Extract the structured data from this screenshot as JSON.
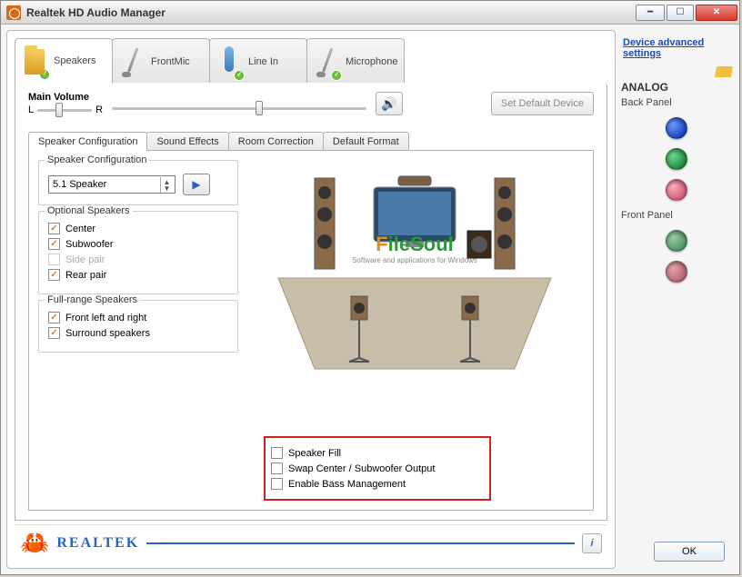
{
  "window": {
    "title": "Realtek HD Audio Manager"
  },
  "devtabs": {
    "speakers": "Speakers",
    "frontmic": "FrontMic",
    "linein": "Line In",
    "microphone": "Microphone"
  },
  "mainvol": {
    "label": "Main Volume",
    "L": "L",
    "R": "R",
    "setdef": "Set Default Device"
  },
  "innertabs": {
    "cfg": "Speaker Configuration",
    "fx": "Sound Effects",
    "room": "Room Correction",
    "fmt": "Default Format"
  },
  "config": {
    "legend": "Speaker Configuration",
    "value": "5.1 Speaker"
  },
  "optional": {
    "legend": "Optional Speakers",
    "center": "Center",
    "subwoofer": "Subwoofer",
    "sidepair": "Side pair",
    "rearpair": "Rear pair"
  },
  "fullrange": {
    "legend": "Full-range Speakers",
    "front": "Front left and right",
    "surround": "Surround speakers"
  },
  "extra": {
    "fill": "Speaker Fill",
    "swap": "Swap Center / Subwoofer Output",
    "bass": "Enable Bass Management"
  },
  "brand": "REALTEK",
  "side": {
    "adv": "Device advanced settings",
    "analog": "ANALOG",
    "back": "Back Panel",
    "front": "Front Panel"
  },
  "watermark": {
    "f": "F",
    "rest": "ileSoul",
    "sub": "Software and applications for Windows"
  },
  "ok": "OK"
}
